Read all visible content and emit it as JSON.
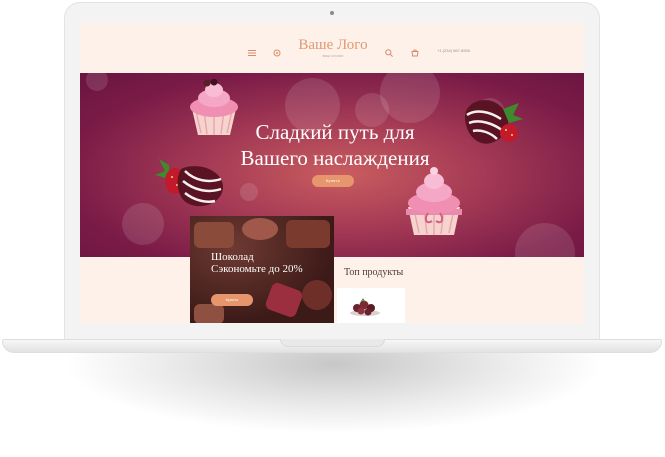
{
  "header": {
    "logo_title": "Ваше Лого",
    "logo_slogan": "ваш слоган",
    "phone": "+1 (234) 567-8900",
    "icons": [
      "menu-icon",
      "gear-icon",
      "search-icon",
      "cart-icon"
    ]
  },
  "hero": {
    "title_line1": "Сладкий путь для",
    "title_line2": "Вашего наслаждения",
    "button_label": "Купить"
  },
  "promo": {
    "title_line1": "Шоколад",
    "title_line2": "Сэкономьте до 20%",
    "button_label": "Купить"
  },
  "products": {
    "section_title": "Топ продукты"
  },
  "colors": {
    "accent": "#e6956c",
    "hero_dark": "#7a1b47",
    "hero_light": "#c95d5f",
    "page_bg": "#fdf1ea",
    "logo": "#e29a70"
  }
}
